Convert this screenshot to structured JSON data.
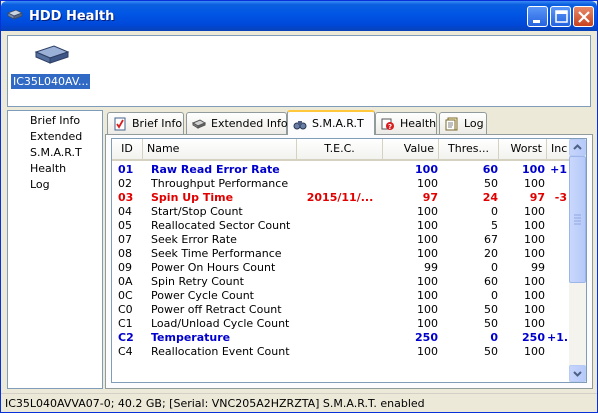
{
  "window": {
    "title": "HDD Health"
  },
  "devices": [
    {
      "label": "IC35L040AV..."
    }
  ],
  "sidebar": {
    "items": [
      {
        "label": "Brief Info"
      },
      {
        "label": "Extended"
      },
      {
        "label": "S.M.A.R.T"
      },
      {
        "label": "Health"
      },
      {
        "label": "Log"
      }
    ]
  },
  "tabs": [
    {
      "label": "Brief Info",
      "icon": "checklist-icon"
    },
    {
      "label": "Extended Info",
      "icon": "drive-icon"
    },
    {
      "label": "S.M.A.R.T",
      "icon": "binoculars-icon",
      "active": true
    },
    {
      "label": "Health",
      "icon": "health-icon"
    },
    {
      "label": "Log",
      "icon": "log-icon"
    }
  ],
  "table": {
    "headers": {
      "id": "ID",
      "name": "Name",
      "tec": "T.E.C.",
      "value": "Value",
      "threshold": "Thres...",
      "worst": "Worst",
      "inc": "Inc"
    },
    "rows": [
      {
        "id": "01",
        "name": "Raw Read Error Rate",
        "tec": "",
        "value": "100",
        "threshold": "60",
        "worst": "100",
        "inc": "+1",
        "style": "blue"
      },
      {
        "id": "02",
        "name": "Throughput Performance",
        "tec": "",
        "value": "100",
        "threshold": "50",
        "worst": "100",
        "inc": "",
        "style": "normal"
      },
      {
        "id": "03",
        "name": "Spin Up Time",
        "tec": "2015/11/...",
        "value": "97",
        "threshold": "24",
        "worst": "97",
        "inc": "-3",
        "style": "red"
      },
      {
        "id": "04",
        "name": "Start/Stop Count",
        "tec": "",
        "value": "100",
        "threshold": "0",
        "worst": "100",
        "inc": "",
        "style": "normal"
      },
      {
        "id": "05",
        "name": "Reallocated Sector Count",
        "tec": "",
        "value": "100",
        "threshold": "5",
        "worst": "100",
        "inc": "",
        "style": "normal"
      },
      {
        "id": "07",
        "name": "Seek Error Rate",
        "tec": "",
        "value": "100",
        "threshold": "67",
        "worst": "100",
        "inc": "",
        "style": "normal"
      },
      {
        "id": "08",
        "name": "Seek Time Performance",
        "tec": "",
        "value": "100",
        "threshold": "20",
        "worst": "100",
        "inc": "",
        "style": "normal"
      },
      {
        "id": "09",
        "name": "Power On Hours Count",
        "tec": "",
        "value": "99",
        "threshold": "0",
        "worst": "99",
        "inc": "",
        "style": "normal"
      },
      {
        "id": "0A",
        "name": "Spin Retry Count",
        "tec": "",
        "value": "100",
        "threshold": "60",
        "worst": "100",
        "inc": "",
        "style": "normal"
      },
      {
        "id": "0C",
        "name": "Power Cycle Count",
        "tec": "",
        "value": "100",
        "threshold": "0",
        "worst": "100",
        "inc": "",
        "style": "normal"
      },
      {
        "id": "C0",
        "name": "Power off Retract Count",
        "tec": "",
        "value": "100",
        "threshold": "50",
        "worst": "100",
        "inc": "",
        "style": "normal"
      },
      {
        "id": "C1",
        "name": "Load/Unload Cycle Count",
        "tec": "",
        "value": "100",
        "threshold": "50",
        "worst": "100",
        "inc": "",
        "style": "normal"
      },
      {
        "id": "C2",
        "name": "Temperature",
        "tec": "",
        "value": "250",
        "threshold": "0",
        "worst": "250",
        "inc": "+1...",
        "style": "blue"
      },
      {
        "id": "C4",
        "name": "Reallocation Event Count",
        "tec": "",
        "value": "100",
        "threshold": "50",
        "worst": "100",
        "inc": "",
        "style": "normal"
      }
    ]
  },
  "statusbar": {
    "text": "IC35L040AVVA07-0;   40.2 GB;  [Serial: VNC205A2HZRZTA]   S.M.A.R.T. enabled"
  },
  "colors": {
    "accent_blue": "#0000CC",
    "alert_red": "#E00000",
    "selection": "#316AC5",
    "titlebar": "#0055E5"
  }
}
